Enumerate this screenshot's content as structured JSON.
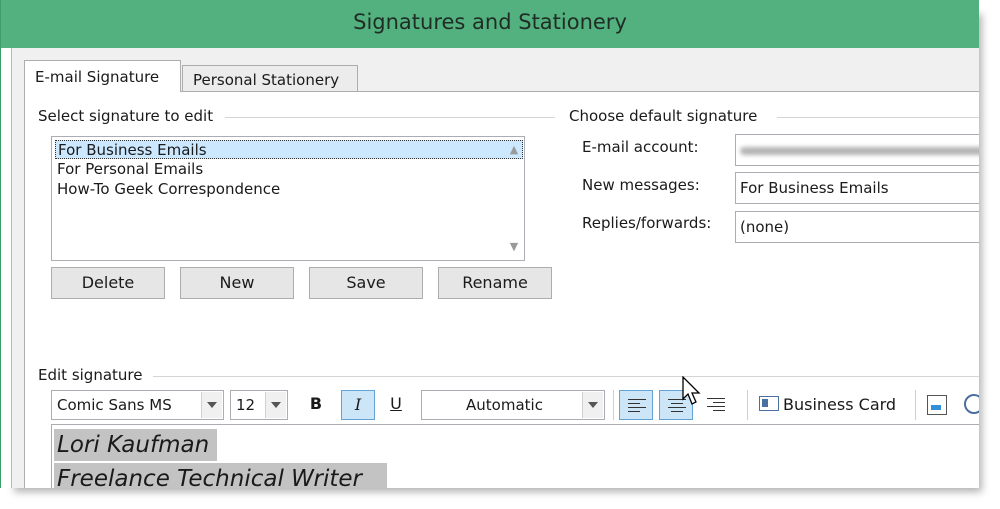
{
  "window": {
    "title": "Signatures and Stationery"
  },
  "tabs": [
    {
      "label": "E-mail Signature",
      "active": true
    },
    {
      "label": "Personal Stationery",
      "active": false
    }
  ],
  "select_group": {
    "label": "Select signature to edit",
    "items": [
      "For Business Emails",
      "For Personal Emails",
      "How-To Geek Correspondence"
    ],
    "selected_index": 0
  },
  "buttons": {
    "delete": "Delete",
    "new": "New",
    "save": "Save",
    "rename": "Rename"
  },
  "default_group": {
    "label": "Choose default signature",
    "email_account_label": "E-mail account:",
    "new_messages_label": "New messages:",
    "new_messages_value": "For Business Emails",
    "replies_label": "Replies/forwards:",
    "replies_value": "(none)"
  },
  "edit_group": {
    "label": "Edit signature",
    "font": "Comic Sans MS",
    "size": "12",
    "bold": "B",
    "italic": "I",
    "underline": "U",
    "color": "Automatic",
    "business_card": "Business Card"
  },
  "signature": {
    "line1": "Lori Kaufman",
    "line2": "Freelance Technical Writer"
  },
  "colors": {
    "titlebar": "#53b07f",
    "selection": "#cce8ff",
    "toggle_active": "#cde6f7",
    "signature_highlight": "#c3c3c3"
  },
  "icons": [
    "chevron-up-icon",
    "chevron-down-icon",
    "align-left-icon",
    "align-center-icon",
    "align-right-icon",
    "business-card-icon",
    "picture-icon",
    "hyperlink-icon",
    "mouse-cursor-icon"
  ]
}
